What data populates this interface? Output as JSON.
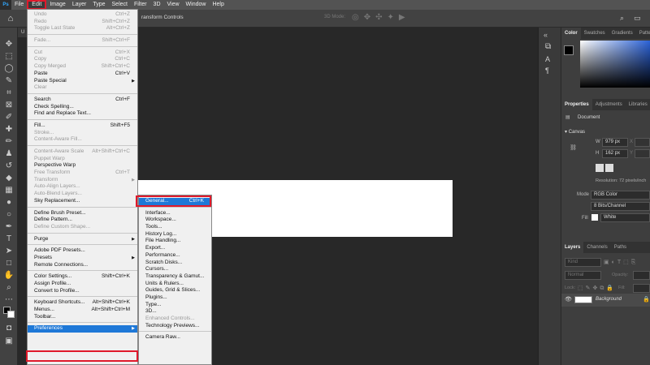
{
  "menubar": {
    "logo": "Ps",
    "items": [
      "File",
      "Edit",
      "Image",
      "Layer",
      "Type",
      "Select",
      "Filter",
      "3D",
      "View",
      "Window",
      "Help"
    ]
  },
  "optionsbar": {
    "transform_controls": "ransform Controls",
    "mode3d": "3D Mode:"
  },
  "edit_menu": {
    "items": [
      {
        "label": "Undo",
        "shortcut": "Ctrl+Z",
        "disabled": true
      },
      {
        "label": "Redo",
        "shortcut": "Shift+Ctrl+Z",
        "disabled": true
      },
      {
        "label": "Toggle Last State",
        "shortcut": "Alt+Ctrl+Z",
        "disabled": true
      },
      {
        "sep": true
      },
      {
        "label": "Fade...",
        "shortcut": "Shift+Ctrl+F",
        "disabled": true
      },
      {
        "sep": true
      },
      {
        "label": "Cut",
        "shortcut": "Ctrl+X",
        "disabled": true
      },
      {
        "label": "Copy",
        "shortcut": "Ctrl+C",
        "disabled": true
      },
      {
        "label": "Copy Merged",
        "shortcut": "Shift+Ctrl+C",
        "disabled": true
      },
      {
        "label": "Paste",
        "shortcut": "Ctrl+V",
        "disabled": false
      },
      {
        "label": "Paste Special",
        "shortcut": "",
        "disabled": false,
        "submenu": true
      },
      {
        "label": "Clear",
        "shortcut": "",
        "disabled": true
      },
      {
        "sep": true
      },
      {
        "label": "Search",
        "shortcut": "Ctrl+F",
        "disabled": false
      },
      {
        "label": "Check Spelling...",
        "shortcut": "",
        "disabled": false
      },
      {
        "label": "Find and Replace Text...",
        "shortcut": "",
        "disabled": false
      },
      {
        "sep": true
      },
      {
        "label": "Fill...",
        "shortcut": "Shift+F5",
        "disabled": false
      },
      {
        "label": "Stroke...",
        "shortcut": "",
        "disabled": true
      },
      {
        "label": "Content-Aware Fill...",
        "shortcut": "",
        "disabled": true
      },
      {
        "sep": true
      },
      {
        "label": "Content-Aware Scale",
        "shortcut": "Alt+Shift+Ctrl+C",
        "disabled": true
      },
      {
        "label": "Puppet Warp",
        "shortcut": "",
        "disabled": true
      },
      {
        "label": "Perspective Warp",
        "shortcut": "",
        "disabled": false
      },
      {
        "label": "Free Transform",
        "shortcut": "Ctrl+T",
        "disabled": true
      },
      {
        "label": "Transform",
        "shortcut": "",
        "disabled": true,
        "submenu": true
      },
      {
        "label": "Auto-Align Layers...",
        "shortcut": "",
        "disabled": true
      },
      {
        "label": "Auto-Blend Layers...",
        "shortcut": "",
        "disabled": true
      },
      {
        "label": "Sky Replacement...",
        "shortcut": "",
        "disabled": false
      },
      {
        "sep": true
      },
      {
        "label": "Define Brush Preset...",
        "shortcut": "",
        "disabled": false
      },
      {
        "label": "Define Pattern...",
        "shortcut": "",
        "disabled": false
      },
      {
        "label": "Define Custom Shape...",
        "shortcut": "",
        "disabled": true
      },
      {
        "sep": true
      },
      {
        "label": "Purge",
        "shortcut": "",
        "disabled": false,
        "submenu": true
      },
      {
        "sep": true
      },
      {
        "label": "Adobe PDF Presets...",
        "shortcut": "",
        "disabled": false
      },
      {
        "label": "Presets",
        "shortcut": "",
        "disabled": false,
        "submenu": true
      },
      {
        "label": "Remote Connections...",
        "shortcut": "",
        "disabled": false
      },
      {
        "sep": true
      },
      {
        "label": "Color Settings...",
        "shortcut": "Shift+Ctrl+K",
        "disabled": false
      },
      {
        "label": "Assign Profile...",
        "shortcut": "",
        "disabled": false
      },
      {
        "label": "Convert to Profile...",
        "shortcut": "",
        "disabled": false
      },
      {
        "sep": true
      },
      {
        "label": "Keyboard Shortcuts...",
        "shortcut": "Alt+Shift+Ctrl+K",
        "disabled": false
      },
      {
        "label": "Menus...",
        "shortcut": "Alt+Shift+Ctrl+M",
        "disabled": false
      },
      {
        "label": "Toolbar...",
        "shortcut": "",
        "disabled": false
      },
      {
        "sep": true
      },
      {
        "label": "Preferences",
        "shortcut": "",
        "disabled": false,
        "submenu": true,
        "highlight": true
      }
    ]
  },
  "prefs_menu": {
    "items": [
      {
        "label": "General...",
        "shortcut": "Ctrl+K",
        "highlight": true
      },
      {
        "sep": true
      },
      {
        "label": "Interface..."
      },
      {
        "label": "Workspace..."
      },
      {
        "label": "Tools..."
      },
      {
        "label": "History Log..."
      },
      {
        "label": "File Handling..."
      },
      {
        "label": "Export..."
      },
      {
        "label": "Performance..."
      },
      {
        "label": "Scratch Disks..."
      },
      {
        "label": "Cursors..."
      },
      {
        "label": "Transparency & Gamut..."
      },
      {
        "label": "Units & Rulers..."
      },
      {
        "label": "Guides, Grid & Slices..."
      },
      {
        "label": "Plugins..."
      },
      {
        "label": "Type..."
      },
      {
        "label": "3D..."
      },
      {
        "label": "Enhanced Controls...",
        "disabled": true
      },
      {
        "label": "Technology Previews..."
      },
      {
        "sep": true
      },
      {
        "label": "Camera Raw..."
      }
    ]
  },
  "color_panel": {
    "tabs": [
      "Color",
      "Swatches",
      "Gradients",
      "Patterns"
    ]
  },
  "properties_panel": {
    "tabs": [
      "Properties",
      "Adjustments",
      "Libraries"
    ],
    "doc_label": "Document",
    "canvas_label": "Canvas",
    "w_label": "W",
    "w_value": "979 px",
    "h_label": "H",
    "h_value": "162 px",
    "x_label": "X",
    "y_label": "Y",
    "resolution": "Resolution: 72 pixels/inch",
    "mode_label": "Mode",
    "mode_value": "RGB Color",
    "bits_value": "8 Bits/Channel",
    "fill_label": "Fill",
    "fill_value": "White"
  },
  "layers_panel": {
    "tabs": [
      "Layers",
      "Channels",
      "Paths"
    ],
    "kind_placeholder": "Kind",
    "blend": "Normal",
    "opacity_label": "Opacity:",
    "lock_label": "Lock:",
    "fill_label": "Fill:",
    "layer_name": "Background"
  },
  "colors": {
    "highlight": "#1e78d7",
    "annotation": "#e0192b"
  }
}
